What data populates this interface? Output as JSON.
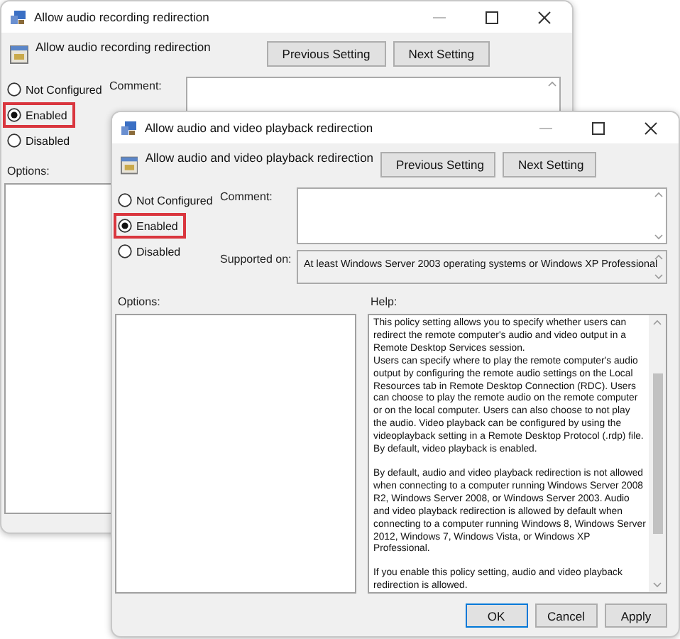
{
  "windows": [
    {
      "title": "Allow audio recording redirection",
      "setting_name": "Allow audio recording redirection",
      "nav_buttons": [
        "Previous Setting",
        "Next Setting"
      ],
      "states": [
        {
          "label": "Not Configured",
          "selected": false,
          "highlighted": false
        },
        {
          "label": "Enabled",
          "selected": true,
          "highlighted": true
        },
        {
          "label": "Disabled",
          "selected": false,
          "highlighted": false
        }
      ],
      "comment_label": "Comment:",
      "options_label": "Options:"
    },
    {
      "title": "Allow audio and video playback redirection",
      "setting_name": "Allow audio and video playback redirection",
      "nav_buttons": [
        "Previous Setting",
        "Next Setting"
      ],
      "states": [
        {
          "label": "Not Configured",
          "selected": false,
          "highlighted": false
        },
        {
          "label": "Enabled",
          "selected": true,
          "highlighted": true
        },
        {
          "label": "Disabled",
          "selected": false,
          "highlighted": false
        }
      ],
      "comment_label": "Comment:",
      "supported_label": "Supported on:",
      "supported_value": "At least Windows Server 2003 operating systems or Windows XP Professional",
      "options_label": "Options:",
      "help_label": "Help:",
      "help_paragraphs": [
        "This policy setting allows you to specify whether users can redirect the remote computer's audio and video output in a Remote Desktop Services session.\nUsers can specify where to play the remote computer's audio output by configuring the remote audio settings on the Local Resources tab in Remote Desktop Connection (RDC). Users can choose to play the remote audio on the remote computer or on the local computer. Users can also choose to not play the audio. Video playback can be configured by using the videoplayback setting in a Remote Desktop Protocol (.rdp) file. By default, video playback is enabled.",
        "By default, audio and video playback redirection is not allowed when connecting to a computer running Windows Server 2008 R2, Windows Server 2008, or Windows Server 2003. Audio and video playback redirection is allowed by default when connecting to a computer running Windows 8, Windows Server 2012, Windows 7, Windows Vista, or Windows XP Professional.",
        "If you enable this policy setting, audio and video playback redirection is allowed."
      ],
      "footer_buttons": [
        "OK",
        "Cancel",
        "Apply"
      ]
    }
  ]
}
